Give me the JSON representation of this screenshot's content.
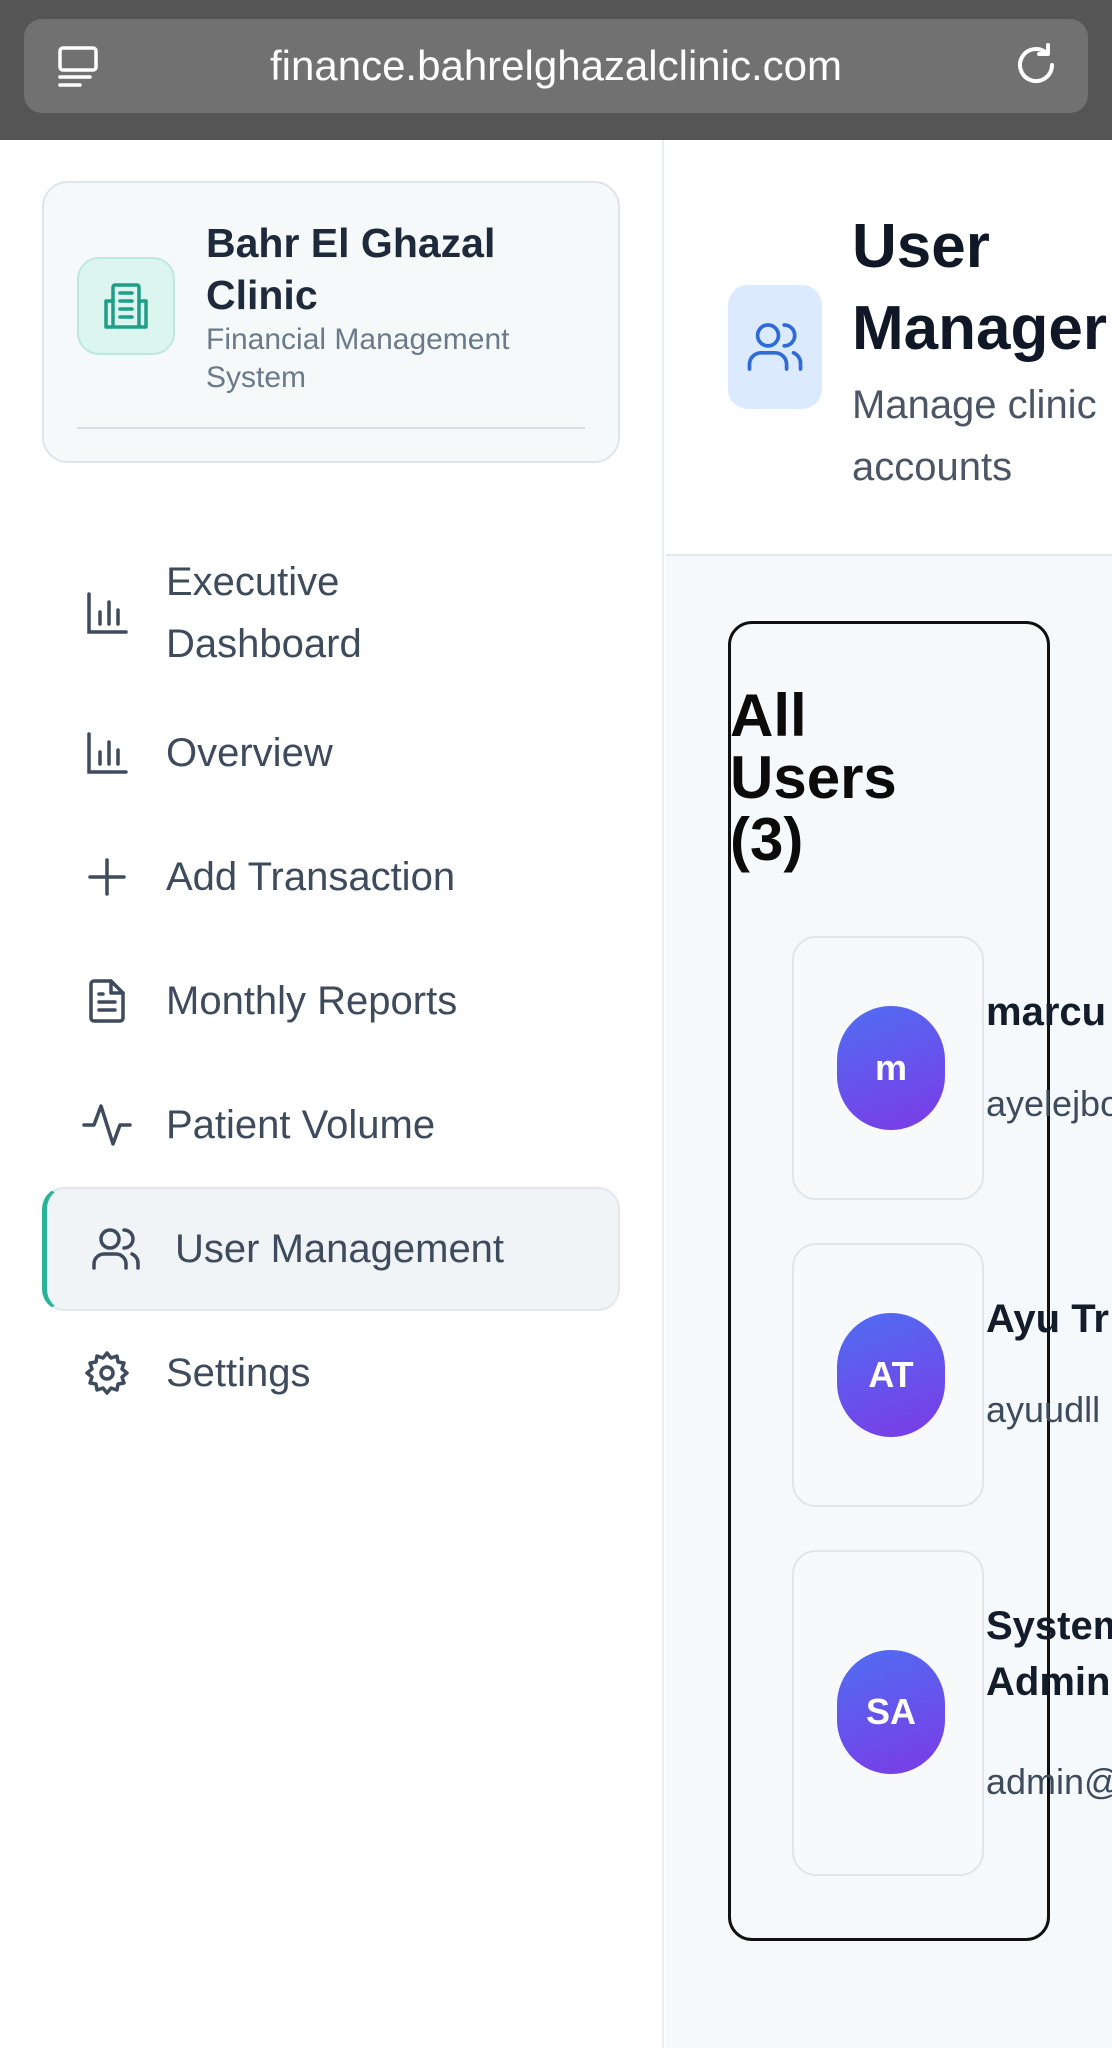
{
  "browser": {
    "url": "finance.bahrelghazalclinic.com"
  },
  "brand": {
    "name": "Bahr El Ghazal Clinic",
    "subtitle": "Financial Management System",
    "accent_color": "#2ab39b"
  },
  "nav": {
    "items": [
      {
        "label": "Executive Dashboard",
        "icon": "bar-chart-icon",
        "active": false
      },
      {
        "label": "Overview",
        "icon": "bar-chart-icon",
        "active": false
      },
      {
        "label": "Add Transaction",
        "icon": "plus-icon",
        "active": false
      },
      {
        "label": "Monthly Reports",
        "icon": "document-icon",
        "active": false
      },
      {
        "label": "Patient Volume",
        "icon": "activity-icon",
        "active": false
      },
      {
        "label": "User Management",
        "icon": "users-icon",
        "active": true
      },
      {
        "label": "Settings",
        "icon": "gear-icon",
        "active": false
      }
    ]
  },
  "page": {
    "title": "User Manager",
    "subtitle": "Manage clinic accounts"
  },
  "users": {
    "heading": "All Users (3)",
    "list": [
      {
        "initials": "m",
        "name": "marcu",
        "email": "ayelejbo"
      },
      {
        "initials": "AT",
        "name": "Ayu Tr",
        "email": "ayuudll"
      },
      {
        "initials": "SA",
        "name": "System Admin",
        "email": "admin@"
      }
    ]
  }
}
